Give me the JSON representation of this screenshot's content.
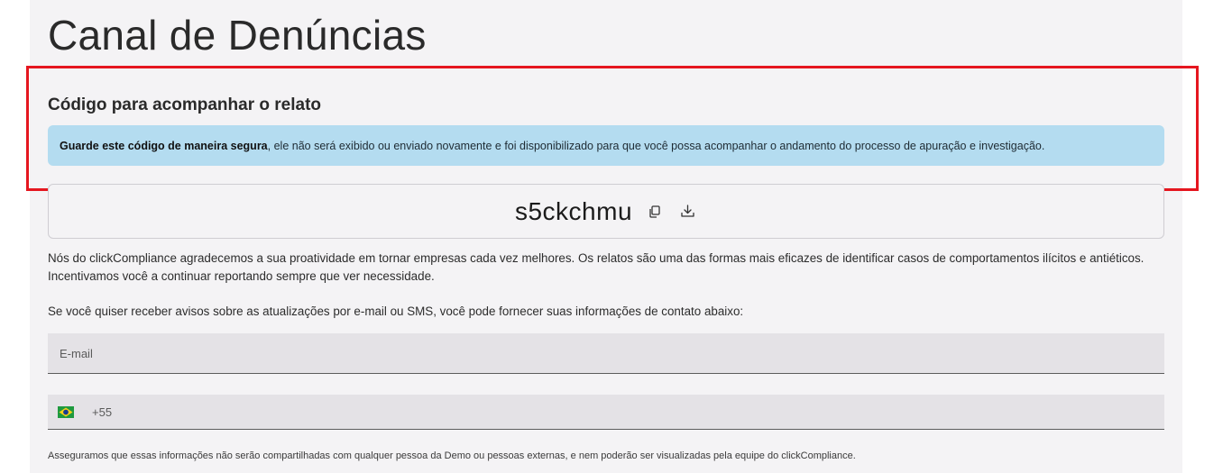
{
  "page": {
    "title": "Canal de Denúncias"
  },
  "code_section": {
    "title": "Código para acompanhar o relato",
    "notice_bold": "Guarde este código de maneira segura",
    "notice_rest": ", ele não será exibido ou enviado novamente e foi disponibilizado para que você possa acompanhar o andamento do processo de apuração e investigação.",
    "code": "s5ckchmu",
    "copy_icon": "copy-icon",
    "download_icon": "download-icon"
  },
  "thanks_text": "Nós do clickCompliance agradecemos a sua proatividade em tornar empresas cada vez melhores. Os relatos são uma das formas mais eficazes de identificar casos de comportamentos ilícitos e antiéticos.",
  "encourage_text": "Incentivamos você a continuar reportando sempre que ver necessidade.",
  "contact_prompt": "Se você quiser receber avisos sobre as atualizações por e-mail ou SMS, você pode fornecer suas informações de contato abaixo:",
  "email_field": {
    "placeholder": "E-mail",
    "value": ""
  },
  "phone_field": {
    "country_flag": "brazil-flag-icon",
    "dial_code": "+55",
    "value": ""
  },
  "footnote": "Asseguramos que essas informações não serão compartilhadas com qualquer pessoa da Demo ou pessoas externas, e nem poderão ser visualizadas pela equipe do clickCompliance.",
  "colors": {
    "notice_bg": "#b4dcf0",
    "highlight_border": "#e5161f",
    "panel_bg": "#f4f3f5",
    "field_bg": "#e4e2e6"
  }
}
